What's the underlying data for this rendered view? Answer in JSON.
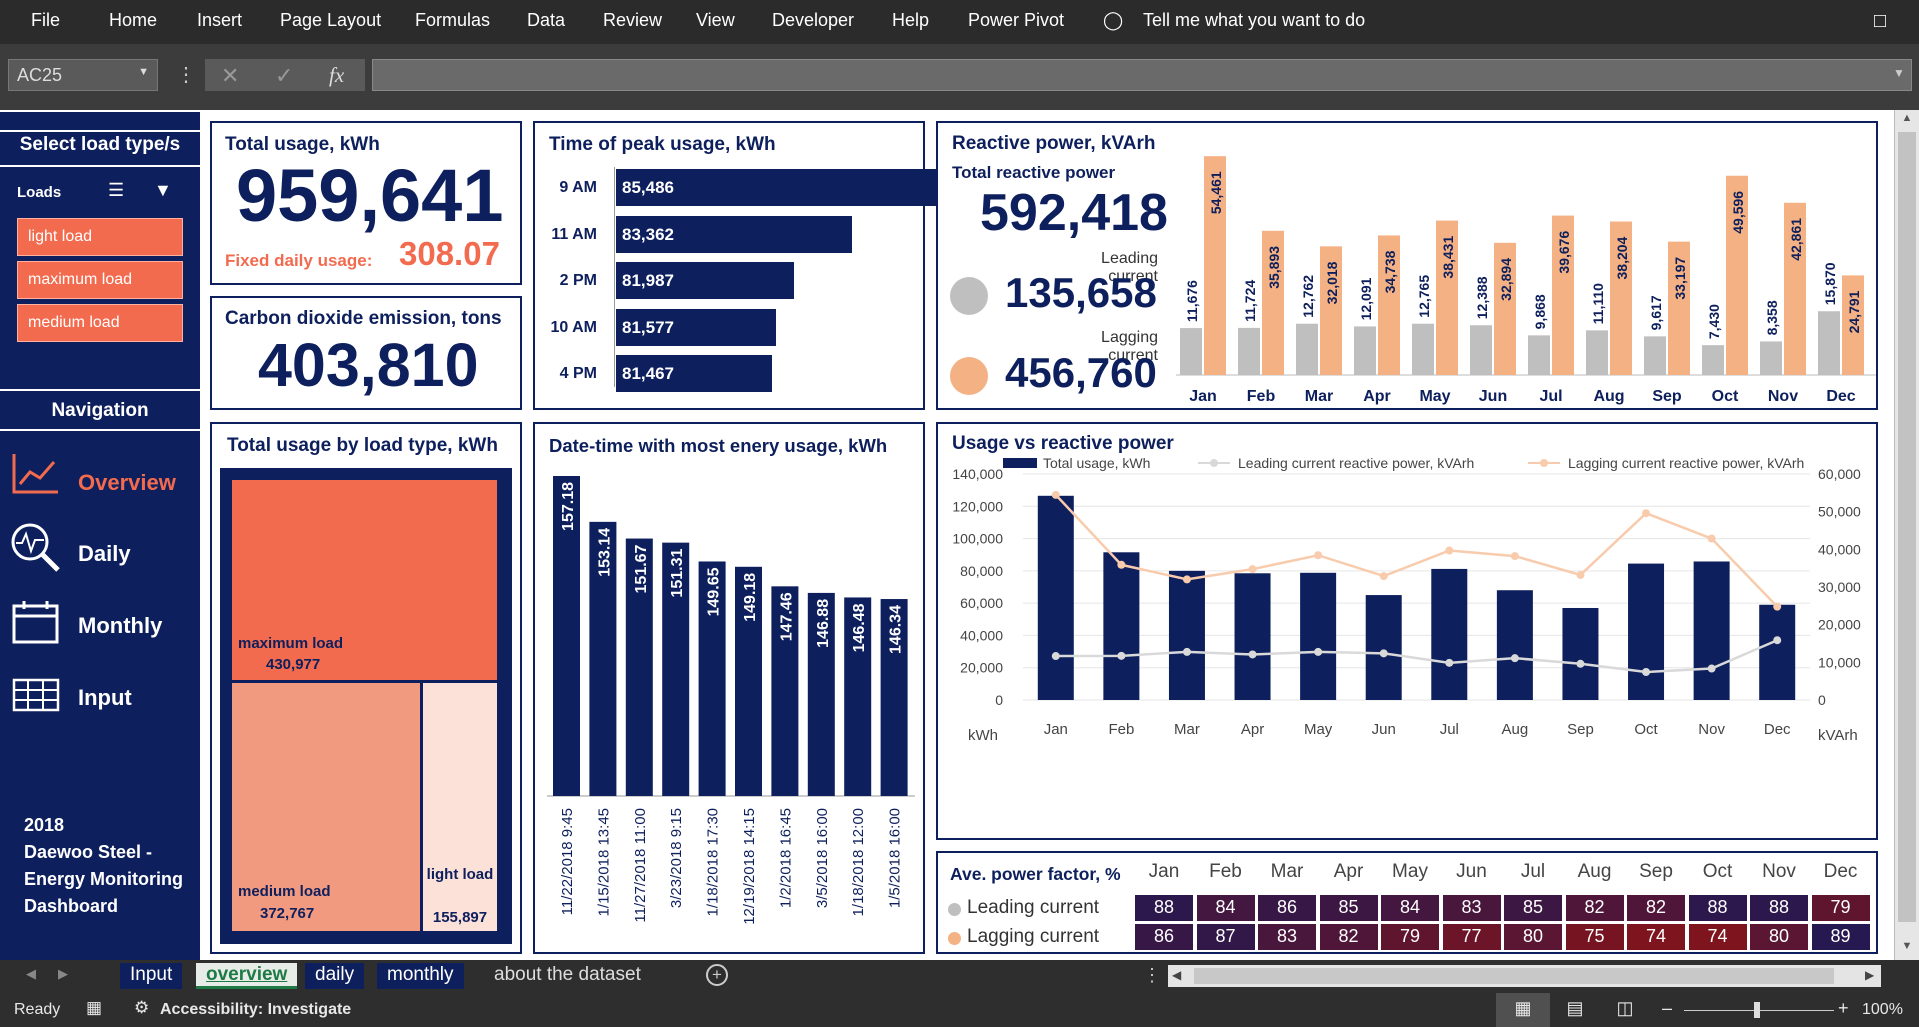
{
  "ribbon": {
    "menu": [
      "File",
      "Home",
      "Insert",
      "Page Layout",
      "Formulas",
      "Data",
      "Review",
      "View",
      "Developer",
      "Help",
      "Power Pivot"
    ],
    "tell_me": "Tell me what you want to do"
  },
  "formula_bar": {
    "name_box": "AC25",
    "formula": ""
  },
  "slicer": {
    "title": "Select load type/s",
    "header": "Loads",
    "items": [
      "light load",
      "maximum load",
      "medium load"
    ]
  },
  "navigation": {
    "title": "Navigation",
    "items": [
      "Overview",
      "Daily",
      "Monthly",
      "Input"
    ],
    "footer": "2018\nDaewoo Steel - Energy Monitoring Dashboard"
  },
  "total_usage": {
    "title": "Total usage, kWh",
    "value": "959,641",
    "fixed_label": "Fixed daily usage:",
    "fixed_value": "308.07"
  },
  "co2": {
    "title": "Carbon dioxide emission, tons",
    "value": "403,810"
  },
  "peak": {
    "title": "Time of peak usage, kWh",
    "rows": [
      {
        "label": "9 AM",
        "value": 85486,
        "text": "85,486"
      },
      {
        "label": "11 AM",
        "value": 83362,
        "text": "83,362"
      },
      {
        "label": "2 PM",
        "value": 81987,
        "text": "81,987"
      },
      {
        "label": "10 AM",
        "value": 81577,
        "text": "81,577"
      },
      {
        "label": "4 PM",
        "value": 81467,
        "text": "81,467"
      }
    ]
  },
  "reactive": {
    "title": "Reactive power, kVArh",
    "total_label": "Total reactive power",
    "total": "592,418",
    "leading_label": "Leading current",
    "leading": "135,658",
    "lagging_label": "Lagging current",
    "lagging": "456,760",
    "months": [
      "Jan",
      "Feb",
      "Mar",
      "Apr",
      "May",
      "Jun",
      "Jul",
      "Aug",
      "Sep",
      "Oct",
      "Nov",
      "Dec"
    ],
    "lead": [
      11676,
      11724,
      12762,
      12091,
      12765,
      12388,
      9868,
      11110,
      9617,
      7430,
      8358,
      15870
    ],
    "lag": [
      54461,
      35893,
      32018,
      34738,
      38431,
      32894,
      39676,
      38204,
      33197,
      49596,
      42861,
      24791
    ]
  },
  "treemap": {
    "title": "Total usage by load type, kWh",
    "items": [
      {
        "name": "maximum load",
        "value": "430,977"
      },
      {
        "name": "medium load",
        "value": "372,767"
      },
      {
        "name": "light load",
        "value": "155,897"
      }
    ]
  },
  "datetime": {
    "title": "Date-time with most enery usage, kWh",
    "labels": [
      "11/22/2018 9:45",
      "1/15/2018 13:45",
      "11/27/2018 11:00",
      "3/23/2018 9:15",
      "1/18/2018 17:30",
      "12/19/2018 14:15",
      "1/2/2018 16:45",
      "3/5/2018 16:00",
      "1/18/2018 12:00",
      "1/5/2018 16:00"
    ],
    "values": [
      157.18,
      153.14,
      151.67,
      151.31,
      149.65,
      149.18,
      147.46,
      146.88,
      146.48,
      146.34
    ]
  },
  "combo": {
    "title": "Usage vs reactive power",
    "legend": [
      "Total usage, kWh",
      "Leading current reactive power, kVArh",
      "Lagging current reactive power, kVArh"
    ],
    "yleft": [
      "140,000",
      "120,000",
      "100,000",
      "80,000",
      "60,000",
      "40,000",
      "20,000",
      "0"
    ],
    "yright": [
      "60,000",
      "50,000",
      "40,000",
      "30,000",
      "20,000",
      "10,000",
      "0"
    ],
    "unit_left": "kWh",
    "unit_right": "kVArh",
    "usage": [
      126500,
      91500,
      80000,
      78500,
      78800,
      65000,
      81200,
      68000,
      57000,
      84500,
      85800,
      59000
    ]
  },
  "pf": {
    "title": "Ave. power factor, %",
    "lead_label": "Leading current",
    "lag_label": "Lagging current",
    "lead": [
      88,
      84,
      86,
      85,
      84,
      83,
      85,
      82,
      82,
      88,
      88,
      79
    ],
    "lag": [
      86,
      87,
      83,
      82,
      79,
      77,
      80,
      75,
      74,
      74,
      80,
      89
    ]
  },
  "sheet_tabs": [
    "Input",
    "overview",
    "daily",
    "monthly",
    "about the dataset"
  ],
  "status": {
    "ready": "Ready",
    "accessibility": "Accessibility: Investigate",
    "zoom": "100%"
  },
  "colors": {
    "navy": "#0d1f5c",
    "orange": "#f26b4f",
    "peach": "#f4b183",
    "gray": "#bfbfbf"
  }
}
